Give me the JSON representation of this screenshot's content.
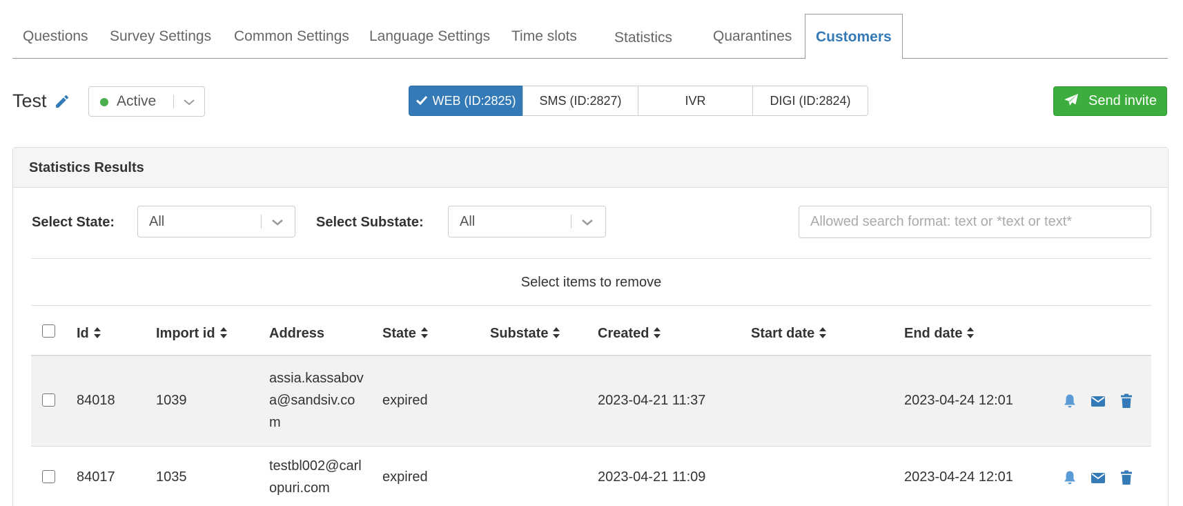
{
  "tabs": [
    {
      "label": "Questions"
    },
    {
      "label": "Survey Settings"
    },
    {
      "label": "Common Settings"
    },
    {
      "label": "Language Settings"
    },
    {
      "label": "Time slots"
    },
    {
      "label": "Statistics"
    },
    {
      "label": "Quarantines"
    },
    {
      "label": "Customers"
    }
  ],
  "survey": {
    "title": "Test",
    "status": "Active"
  },
  "channels": [
    {
      "label": "WEB (ID:2825)"
    },
    {
      "label": "SMS (ID:2827)"
    },
    {
      "label": "IVR"
    },
    {
      "label": "DIGI (ID:2824)"
    }
  ],
  "send_invite_label": "Send invite",
  "panel": {
    "title": "Statistics Results",
    "state_label": "Select State:",
    "state_value": "All",
    "substate_label": "Select Substate:",
    "substate_value": "All",
    "search_placeholder": "Allowed search format: text or *text or text*",
    "remove_label": "Select items to remove"
  },
  "table": {
    "columns": [
      "Id",
      "Import id",
      "Address",
      "State",
      "Substate",
      "Created",
      "Start date",
      "End date"
    ],
    "rows": [
      {
        "id": "84018",
        "import_id": "1039",
        "address": "assia.kassabova@sandsiv.com",
        "state": "expired",
        "substate": "",
        "created": "2023-04-21 11:37",
        "start_date": "",
        "end_date": "2023-04-24 12:01"
      },
      {
        "id": "84017",
        "import_id": "1035",
        "address": "testbl002@carlopuri.com",
        "state": "expired",
        "substate": "",
        "created": "2023-04-21 11:09",
        "start_date": "",
        "end_date": "2023-04-24 12:01"
      }
    ]
  },
  "colors": {
    "primary": "#337ab7",
    "success": "#3dae3d",
    "active_dot": "#4cae4c"
  },
  "icons": [
    "pencil-icon",
    "chevron-down-icon",
    "check-icon",
    "paper-plane-icon",
    "sort-icon",
    "bell-icon",
    "envelope-icon",
    "trash-icon"
  ]
}
